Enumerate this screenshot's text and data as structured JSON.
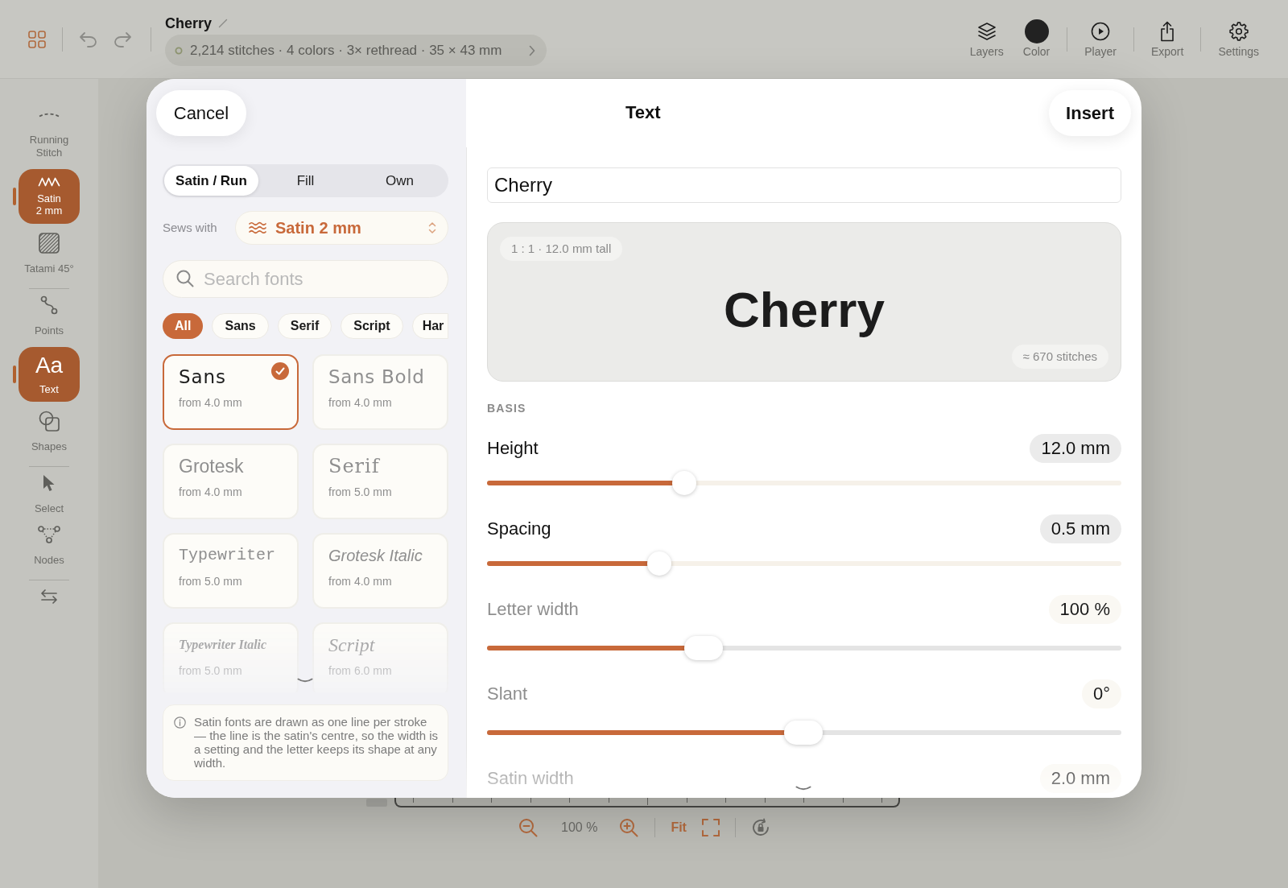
{
  "toolbar": {
    "title": "Cherry",
    "summary": "2,214 stitches · 4 colors · 3× rethread · 35 × 43 mm",
    "groups": [
      {
        "items": [
          {
            "kind": "layers",
            "label": "Layers"
          },
          {
            "kind": "color",
            "label": "Color",
            "color": "#222222"
          }
        ]
      },
      {
        "items": [
          {
            "kind": "player",
            "label": "Player"
          }
        ]
      },
      {
        "items": [
          {
            "kind": "export",
            "label": "Export"
          }
        ]
      },
      {
        "items": [
          {
            "kind": "settings",
            "label": "Settings"
          }
        ]
      }
    ]
  },
  "sidebar": {
    "groups": [
      {
        "items": [
          {
            "kind": "running",
            "label": "Running Stitch",
            "selected": false
          },
          {
            "kind": "satin",
            "label": "Satin 2 mm",
            "selected": true
          },
          {
            "kind": "tatami",
            "label": "Tatami 45°",
            "selected": false
          }
        ]
      },
      {
        "items": [
          {
            "kind": "points",
            "label": "Points",
            "selected": false
          },
          {
            "kind": "text",
            "glyph": "Aa",
            "label": "Text",
            "selected": true
          },
          {
            "kind": "shapes",
            "label": "Shapes",
            "selected": false
          }
        ]
      },
      {
        "items": [
          {
            "kind": "select",
            "label": "Select",
            "selected": false
          },
          {
            "kind": "nodes",
            "label": "Nodes",
            "selected": false
          }
        ]
      },
      {
        "items": [
          {
            "kind": "swap",
            "selected": false
          }
        ]
      }
    ]
  },
  "dialog": {
    "cancel": "Cancel",
    "title": "Text",
    "insert": "Insert",
    "stitch_tabs": [
      {
        "label": "Satin / Run",
        "selected": true
      },
      {
        "label": "Fill",
        "selected": false
      },
      {
        "label": "Own",
        "selected": false
      }
    ],
    "sews_with": {
      "label": "Sews with",
      "value": "Satin 2 mm"
    },
    "search": {
      "placeholder": "Search fonts"
    },
    "filters": [
      {
        "label": "All",
        "selected": true
      },
      {
        "label": "Sans",
        "selected": false
      },
      {
        "label": "Serif",
        "selected": false
      },
      {
        "label": "Script",
        "selected": false
      },
      {
        "label": "Har",
        "selected": false
      }
    ],
    "fonts": [
      {
        "name": "Sans",
        "kind": "sans",
        "min_size": "from 4.0 mm",
        "selected": true
      },
      {
        "name": "Sans Bold",
        "kind": "sansbold",
        "min_size": "from 4.0 mm",
        "selected": false
      },
      {
        "name": "Grotesk",
        "kind": "grotesk",
        "min_size": "from 4.0 mm",
        "selected": false
      },
      {
        "name": "Serif",
        "kind": "serif",
        "min_size": "from 5.0 mm",
        "selected": false
      },
      {
        "name": "Typewriter",
        "kind": "typewriter",
        "min_size": "from 5.0 mm",
        "selected": false
      },
      {
        "name": "Grotesk Italic",
        "kind": "groteskitalic",
        "min_size": "from 4.0 mm",
        "selected": false
      },
      {
        "name": "Typewriter Italic",
        "kind": "typewriteritalic",
        "min_size": "from 5.0 mm",
        "selected": false
      },
      {
        "name": "Script",
        "kind": "script",
        "min_size": "from 6.0 mm",
        "selected": false
      }
    ],
    "info": "Satin fonts are drawn as one line per stroke — the line is the satin's centre, so the width is a setting and the letter keeps its shape at any width.",
    "text_field": {
      "value": "Cherry"
    },
    "preview": {
      "scale": "1 : 1 · 12.0 mm tall",
      "text": "Cherry",
      "stitches": "≈ 670 stitches"
    },
    "section": "BASIS",
    "sliders": [
      {
        "label": "Height",
        "value": "12.0 mm",
        "level": 0.296,
        "dimmed": false
      },
      {
        "label": "Spacing",
        "value": "0.5 mm",
        "level": 0.256,
        "dimmed": false
      },
      {
        "label": "Letter width",
        "value": "100 %",
        "level": 0.315,
        "dimmed": true
      },
      {
        "label": "Slant",
        "value": "0°",
        "level": 0.472,
        "dimmed": true
      },
      {
        "label": "Satin width",
        "value": "2.0 mm",
        "dimmed": true
      }
    ]
  },
  "zoom_bar": {
    "zoom": "100 %",
    "fit": "Fit"
  }
}
